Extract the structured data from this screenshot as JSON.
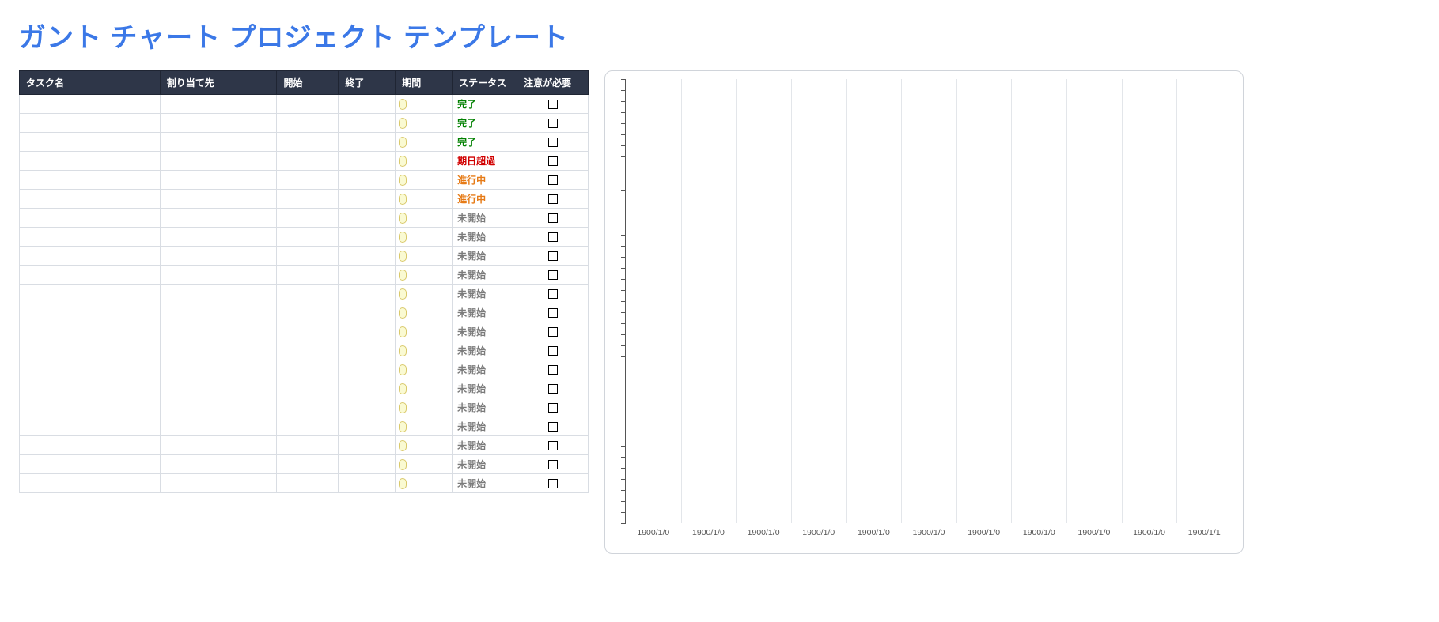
{
  "title": "ガント チャート プロジェクト テンプレート",
  "table": {
    "headers": {
      "taskname": "タスク名",
      "assignee": "割り当て先",
      "start": "開始",
      "end": "終了",
      "duration": "期間",
      "status": "ステータス",
      "attention": "注意が必要"
    },
    "rows": [
      {
        "status": "完了",
        "status_class": "st-green"
      },
      {
        "status": "完了",
        "status_class": "st-green"
      },
      {
        "status": "完了",
        "status_class": "st-green"
      },
      {
        "status": "期日超過",
        "status_class": "st-red"
      },
      {
        "status": "進行中",
        "status_class": "st-orange"
      },
      {
        "status": "進行中",
        "status_class": "st-orange"
      },
      {
        "status": "未開始",
        "status_class": "st-gray"
      },
      {
        "status": "未開始",
        "status_class": "st-gray"
      },
      {
        "status": "未開始",
        "status_class": "st-gray"
      },
      {
        "status": "未開始",
        "status_class": "st-gray"
      },
      {
        "status": "未開始",
        "status_class": "st-gray"
      },
      {
        "status": "未開始",
        "status_class": "st-gray"
      },
      {
        "status": "未開始",
        "status_class": "st-gray"
      },
      {
        "status": "未開始",
        "status_class": "st-gray"
      },
      {
        "status": "未開始",
        "status_class": "st-gray"
      },
      {
        "status": "未開始",
        "status_class": "st-gray"
      },
      {
        "status": "未開始",
        "status_class": "st-gray"
      },
      {
        "status": "未開始",
        "status_class": "st-gray"
      },
      {
        "status": "未開始",
        "status_class": "st-gray"
      },
      {
        "status": "未開始",
        "status_class": "st-gray"
      },
      {
        "status": "未開始",
        "status_class": "st-gray"
      }
    ]
  },
  "chart_data": {
    "type": "bar",
    "categories": [
      "1900/1/0",
      "1900/1/0",
      "1900/1/0",
      "1900/1/0",
      "1900/1/0",
      "1900/1/0",
      "1900/1/0",
      "1900/1/0",
      "1900/1/0",
      "1900/1/0",
      "1900/1/1"
    ],
    "y_tick_count": 40,
    "title": "",
    "xlabel": "",
    "ylabel": "",
    "series": []
  }
}
